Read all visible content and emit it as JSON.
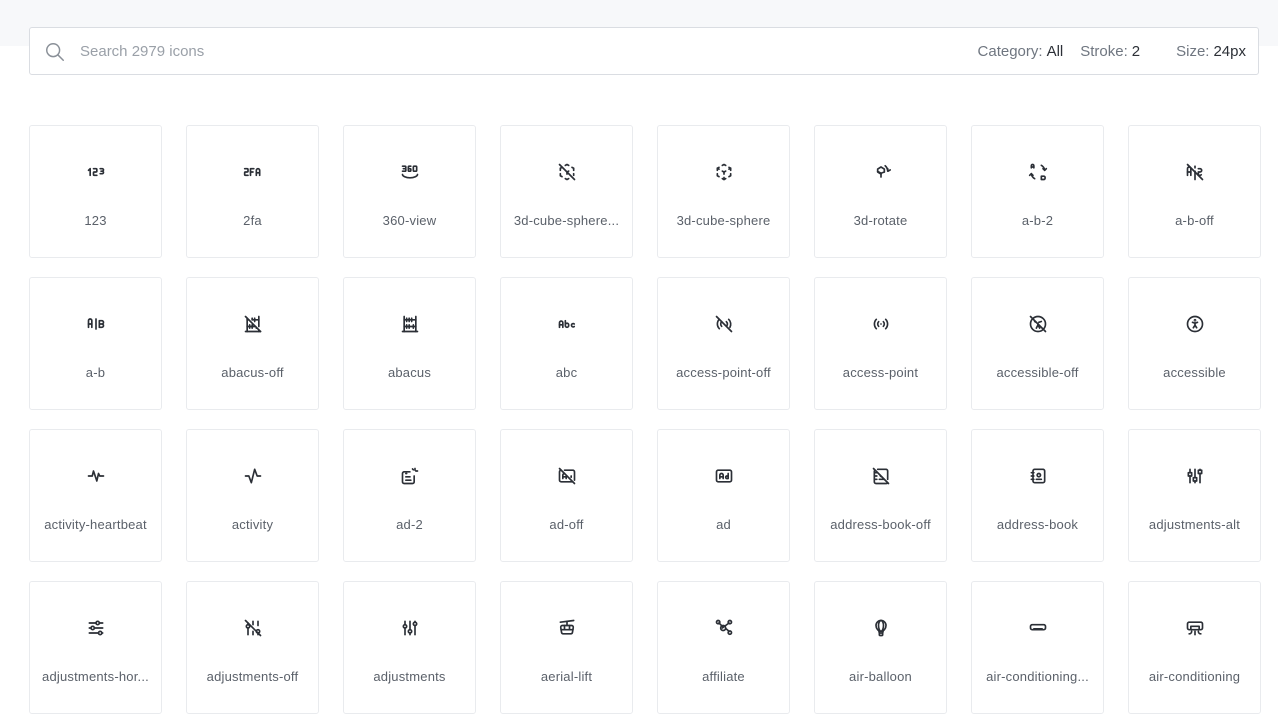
{
  "search": {
    "placeholder": "Search 2979 icons",
    "value": ""
  },
  "filters": {
    "category_label": "Category:",
    "category_value": "All",
    "stroke_label": "Stroke:",
    "stroke_value": "2",
    "size_label": "Size:",
    "size_value": "24px"
  },
  "icons": [
    {
      "label": "123",
      "icon": "123-icon"
    },
    {
      "label": "2fa",
      "icon": "2fa-icon"
    },
    {
      "label": "360-view",
      "icon": "360-view-icon"
    },
    {
      "label": "3d-cube-sphere...",
      "icon": "3d-cube-sphere-off-icon"
    },
    {
      "label": "3d-cube-sphere",
      "icon": "3d-cube-sphere-icon"
    },
    {
      "label": "3d-rotate",
      "icon": "3d-rotate-icon"
    },
    {
      "label": "a-b-2",
      "icon": "a-b-2-icon"
    },
    {
      "label": "a-b-off",
      "icon": "a-b-off-icon"
    },
    {
      "label": "a-b",
      "icon": "a-b-icon"
    },
    {
      "label": "abacus-off",
      "icon": "abacus-off-icon"
    },
    {
      "label": "abacus",
      "icon": "abacus-icon"
    },
    {
      "label": "abc",
      "icon": "abc-icon"
    },
    {
      "label": "access-point-off",
      "icon": "access-point-off-icon"
    },
    {
      "label": "access-point",
      "icon": "access-point-icon"
    },
    {
      "label": "accessible-off",
      "icon": "accessible-off-icon"
    },
    {
      "label": "accessible",
      "icon": "accessible-icon"
    },
    {
      "label": "activity-heartbeat",
      "icon": "activity-heartbeat-icon"
    },
    {
      "label": "activity",
      "icon": "activity-icon"
    },
    {
      "label": "ad-2",
      "icon": "ad-2-icon"
    },
    {
      "label": "ad-off",
      "icon": "ad-off-icon"
    },
    {
      "label": "ad",
      "icon": "ad-icon"
    },
    {
      "label": "address-book-off",
      "icon": "address-book-off-icon"
    },
    {
      "label": "address-book",
      "icon": "address-book-icon"
    },
    {
      "label": "adjustments-alt",
      "icon": "adjustments-alt-icon"
    },
    {
      "label": "adjustments-hor...",
      "icon": "adjustments-horizontal-icon"
    },
    {
      "label": "adjustments-off",
      "icon": "adjustments-off-icon"
    },
    {
      "label": "adjustments",
      "icon": "adjustments-icon"
    },
    {
      "label": "aerial-lift",
      "icon": "aerial-lift-icon"
    },
    {
      "label": "affiliate",
      "icon": "affiliate-icon"
    },
    {
      "label": "air-balloon",
      "icon": "air-balloon-icon"
    },
    {
      "label": "air-conditioning...",
      "icon": "air-conditioning-disabled-icon"
    },
    {
      "label": "air-conditioning",
      "icon": "air-conditioning-icon"
    }
  ]
}
